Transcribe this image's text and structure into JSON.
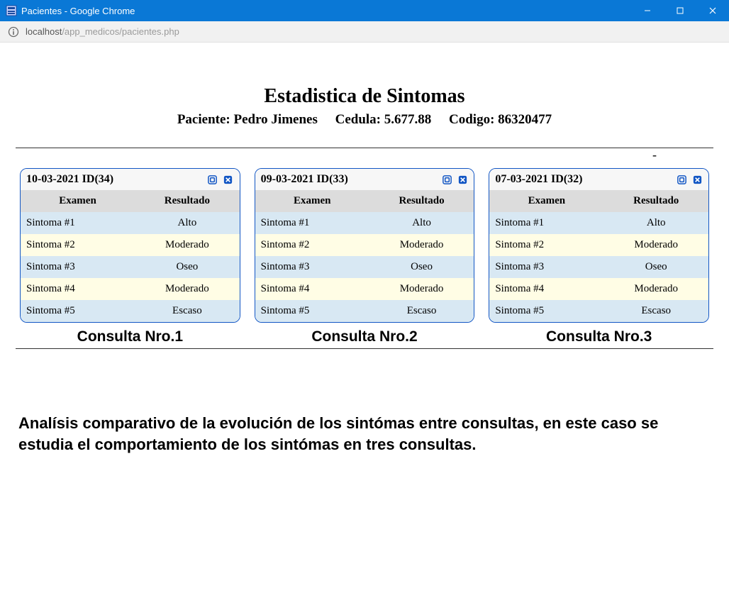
{
  "window": {
    "title": "Pacientes - Google Chrome"
  },
  "urlbar": {
    "host": "localhost",
    "path": "/app_medicos/pacientes.php"
  },
  "header": {
    "title": "Estadistica de Sintomas",
    "patient_label": "Paciente:",
    "patient_name": "Pedro Jimenes",
    "cedula_label": "Cedula:",
    "cedula_value": "5.677.88",
    "codigo_label": "Codigo:",
    "codigo_value": "86320477",
    "dash": "-"
  },
  "table_headers": {
    "examen": "Examen",
    "resultado": "Resultado"
  },
  "panels": [
    {
      "header": "10-03-2021 ID(34)",
      "caption": "Consulta Nro.1",
      "rows": [
        {
          "examen": "Sintoma #1",
          "resultado": "Alto"
        },
        {
          "examen": "Sintoma #2",
          "resultado": "Moderado"
        },
        {
          "examen": "Sintoma #3",
          "resultado": "Oseo"
        },
        {
          "examen": "Sintoma #4",
          "resultado": "Moderado"
        },
        {
          "examen": "Sintoma #5",
          "resultado": "Escaso"
        }
      ]
    },
    {
      "header": "09-03-2021 ID(33)",
      "caption": "Consulta Nro.2",
      "rows": [
        {
          "examen": "Sintoma #1",
          "resultado": "Alto"
        },
        {
          "examen": "Sintoma #2",
          "resultado": "Moderado"
        },
        {
          "examen": "Sintoma #3",
          "resultado": "Oseo"
        },
        {
          "examen": "Sintoma #4",
          "resultado": "Moderado"
        },
        {
          "examen": "Sintoma #5",
          "resultado": "Escaso"
        }
      ]
    },
    {
      "header": "07-03-2021 ID(32)",
      "caption": "Consulta Nro.3",
      "rows": [
        {
          "examen": "Sintoma #1",
          "resultado": "Alto"
        },
        {
          "examen": "Sintoma #2",
          "resultado": "Moderado"
        },
        {
          "examen": "Sintoma #3",
          "resultado": "Oseo"
        },
        {
          "examen": "Sintoma #4",
          "resultado": "Moderado"
        },
        {
          "examen": "Sintoma #5",
          "resultado": "Escaso"
        }
      ]
    }
  ],
  "analysis_text": "Analísis comparativo de la evolución de los sintómas entre consultas, en este caso se estudia el comportamiento de los sintómas en tres consultas."
}
